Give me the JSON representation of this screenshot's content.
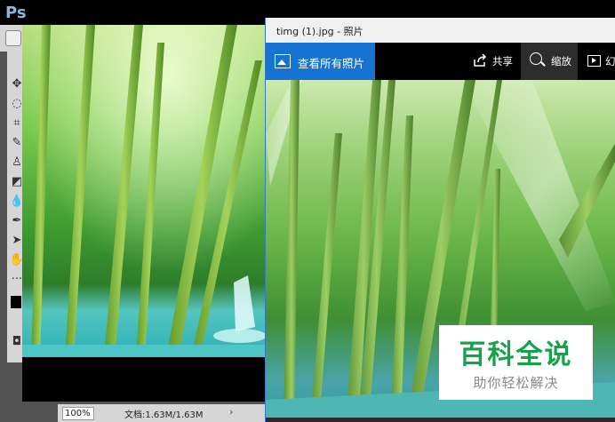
{
  "photoshop": {
    "app_logo": "Ps",
    "zoom_value": "100%",
    "doc_info": "文档:1.63M/1.63M",
    "scroll_arrow": "›",
    "tools": [
      "move-icon",
      "lasso-icon",
      "crop-icon",
      "healing-brush-icon",
      "stamp-icon",
      "eraser-icon",
      "blur-icon",
      "pen-icon",
      "path-select-icon",
      "hand-icon",
      "more-tools-icon",
      "foreground-color-swatch",
      "quick-mask-icon"
    ]
  },
  "photos_app": {
    "title": "timg (1).jpg - 照片",
    "view_all_label": "查看所有照片",
    "share_label": "共享",
    "zoom_label": "缩放",
    "slideshow_label_partial": "幻"
  },
  "watermark": {
    "title": "百科全说",
    "subtitle": "助你轻松解决"
  },
  "colors": {
    "accent_blue": "#1673d2",
    "watermark_green": "#14a34a"
  }
}
